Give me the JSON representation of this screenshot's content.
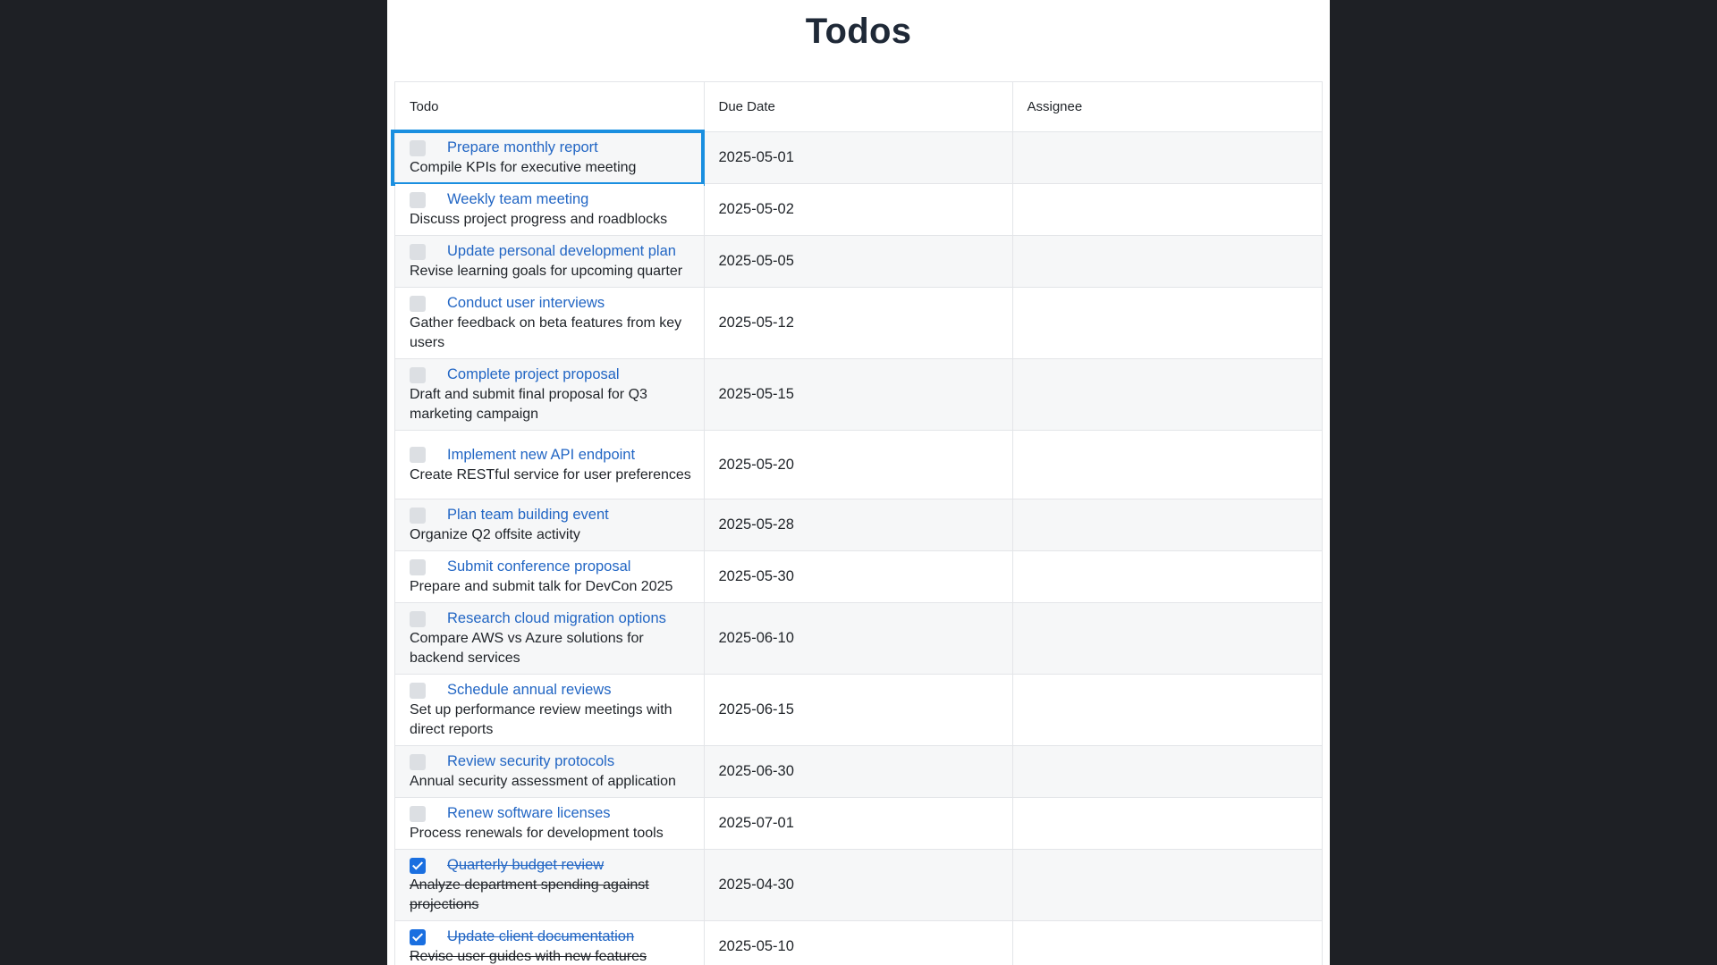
{
  "page": {
    "title": "Todos"
  },
  "table": {
    "headers": {
      "todo": "Todo",
      "due_date": "Due Date",
      "assignee": "Assignee"
    },
    "rows": [
      {
        "title": "Prepare monthly report",
        "description": "Compile KPIs for executive meeting",
        "due_date": "2025-05-01",
        "assignee": "",
        "completed": false,
        "focused": true
      },
      {
        "title": "Weekly team meeting",
        "description": "Discuss project progress and roadblocks",
        "due_date": "2025-05-02",
        "assignee": "",
        "completed": false
      },
      {
        "title": "Update personal development plan",
        "description": "Revise learning goals for upcoming quarter",
        "due_date": "2025-05-05",
        "assignee": "",
        "completed": false
      },
      {
        "title": "Conduct user interviews",
        "description": "Gather feedback on beta features from key users",
        "due_date": "2025-05-12",
        "assignee": "",
        "completed": false
      },
      {
        "title": "Complete project proposal",
        "description": "Draft and submit final proposal for Q3 marketing campaign",
        "due_date": "2025-05-15",
        "assignee": "",
        "completed": false
      },
      {
        "title": "Implement new API endpoint",
        "description": "Create RESTful service for user preferences",
        "due_date": "2025-05-20",
        "assignee": "",
        "completed": false
      },
      {
        "title": "Plan team building event",
        "description": "Organize Q2 offsite activity",
        "due_date": "2025-05-28",
        "assignee": "",
        "completed": false
      },
      {
        "title": "Submit conference proposal",
        "description": "Prepare and submit talk for DevCon 2025",
        "due_date": "2025-05-30",
        "assignee": "",
        "completed": false
      },
      {
        "title": "Research cloud migration options",
        "description": "Compare AWS vs Azure solutions for backend services",
        "due_date": "2025-06-10",
        "assignee": "",
        "completed": false
      },
      {
        "title": "Schedule annual reviews",
        "description": "Set up performance review meetings with direct reports",
        "due_date": "2025-06-15",
        "assignee": "",
        "completed": false
      },
      {
        "title": "Review security protocols",
        "description": "Annual security assessment of application",
        "due_date": "2025-06-30",
        "assignee": "",
        "completed": false
      },
      {
        "title": "Renew software licenses",
        "description": "Process renewals for development tools",
        "due_date": "2025-07-01",
        "assignee": "",
        "completed": false
      },
      {
        "title": "Quarterly budget review",
        "description": "Analyze department spending against projections",
        "due_date": "2025-04-30",
        "assignee": "",
        "completed": true
      },
      {
        "title": "Update client documentation",
        "description": "Revise user guides with new features",
        "due_date": "2025-05-10",
        "assignee": "",
        "completed": true
      }
    ]
  },
  "colors": {
    "background": "#1e2025",
    "link": "#2266c4",
    "checkbox_checked": "#1a6fe0",
    "focus_ring": "#1a8fe0",
    "row_stripe": "#f6f7f8"
  },
  "icons": {
    "unchecked": "checkbox-unchecked-icon",
    "checked": "checkbox-checked-icon"
  }
}
